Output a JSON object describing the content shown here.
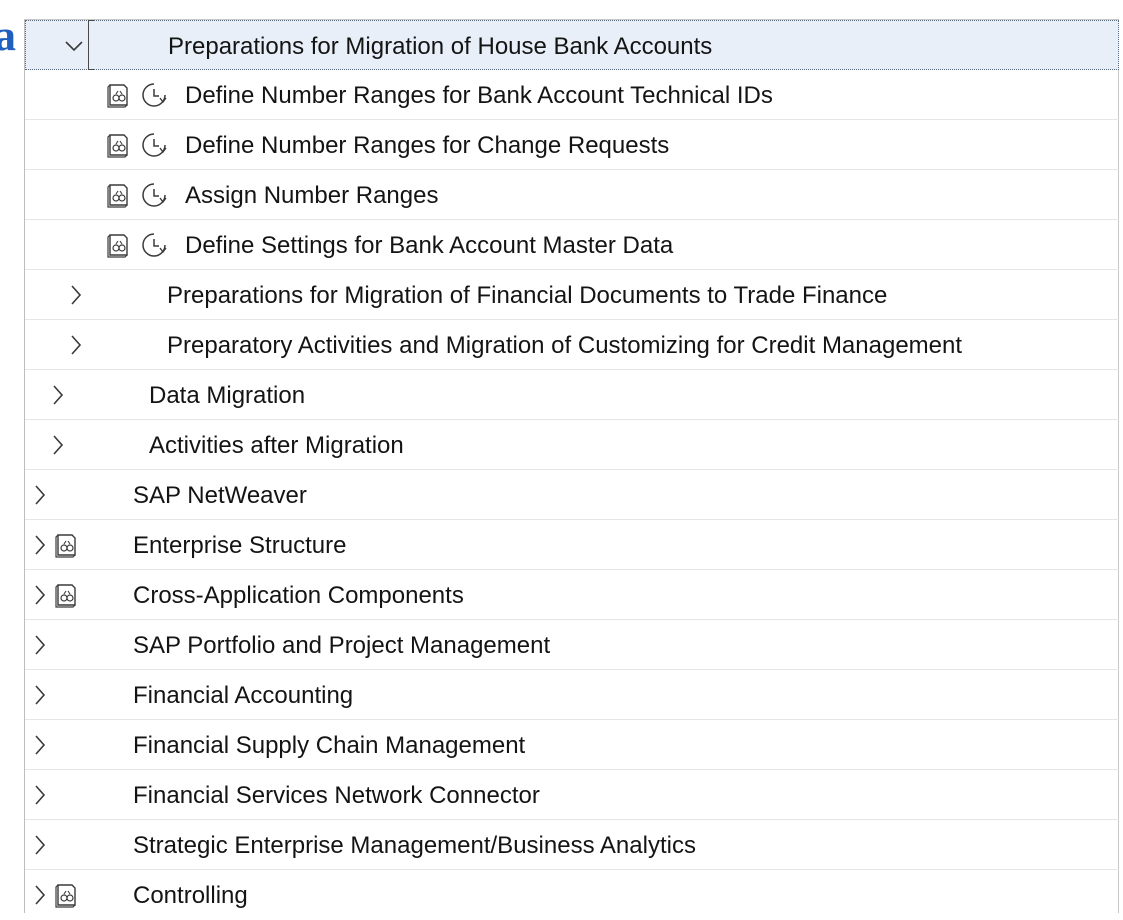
{
  "tree": {
    "rows": [
      {
        "label": "Preparations for Migration of House Bank Accounts",
        "expanded": true,
        "selected": true
      },
      {
        "label": "Define Number Ranges for Bank Account Technical IDs",
        "icons": [
          "documentation-icon",
          "activity-clock-icon"
        ]
      },
      {
        "label": "Define Number Ranges for Change Requests",
        "icons": [
          "documentation-icon",
          "activity-clock-icon"
        ]
      },
      {
        "label": "Assign Number Ranges",
        "icons": [
          "documentation-icon",
          "activity-clock-icon"
        ]
      },
      {
        "label": "Define Settings for Bank Account Master Data",
        "icons": [
          "documentation-icon",
          "activity-clock-icon"
        ]
      },
      {
        "label": "Preparations for Migration of Financial Documents to Trade Finance",
        "expanded": false
      },
      {
        "label": "Preparatory Activities and Migration of Customizing for Credit Management",
        "expanded": false
      },
      {
        "label": "Data Migration",
        "expanded": false
      },
      {
        "label": "Activities after Migration",
        "expanded": false
      },
      {
        "label": "SAP NetWeaver",
        "expanded": false
      },
      {
        "label": "Enterprise Structure",
        "expanded": false,
        "icons": [
          "documentation-icon"
        ]
      },
      {
        "label": "Cross-Application Components",
        "expanded": false,
        "icons": [
          "documentation-icon"
        ]
      },
      {
        "label": "SAP Portfolio and Project Management",
        "expanded": false
      },
      {
        "label": "Financial Accounting",
        "expanded": false
      },
      {
        "label": "Financial Supply Chain Management",
        "expanded": false
      },
      {
        "label": "Financial Services Network Connector",
        "expanded": false
      },
      {
        "label": "Strategic Enterprise Management/Business Analytics",
        "expanded": false
      },
      {
        "label": "Controlling",
        "expanded": false,
        "icons": [
          "documentation-icon"
        ]
      }
    ]
  },
  "colors": {
    "selected_row": "#e8eff8",
    "text": "#141414",
    "icon": "#3a3a3a",
    "edge_accent": "#1f5fbf"
  }
}
